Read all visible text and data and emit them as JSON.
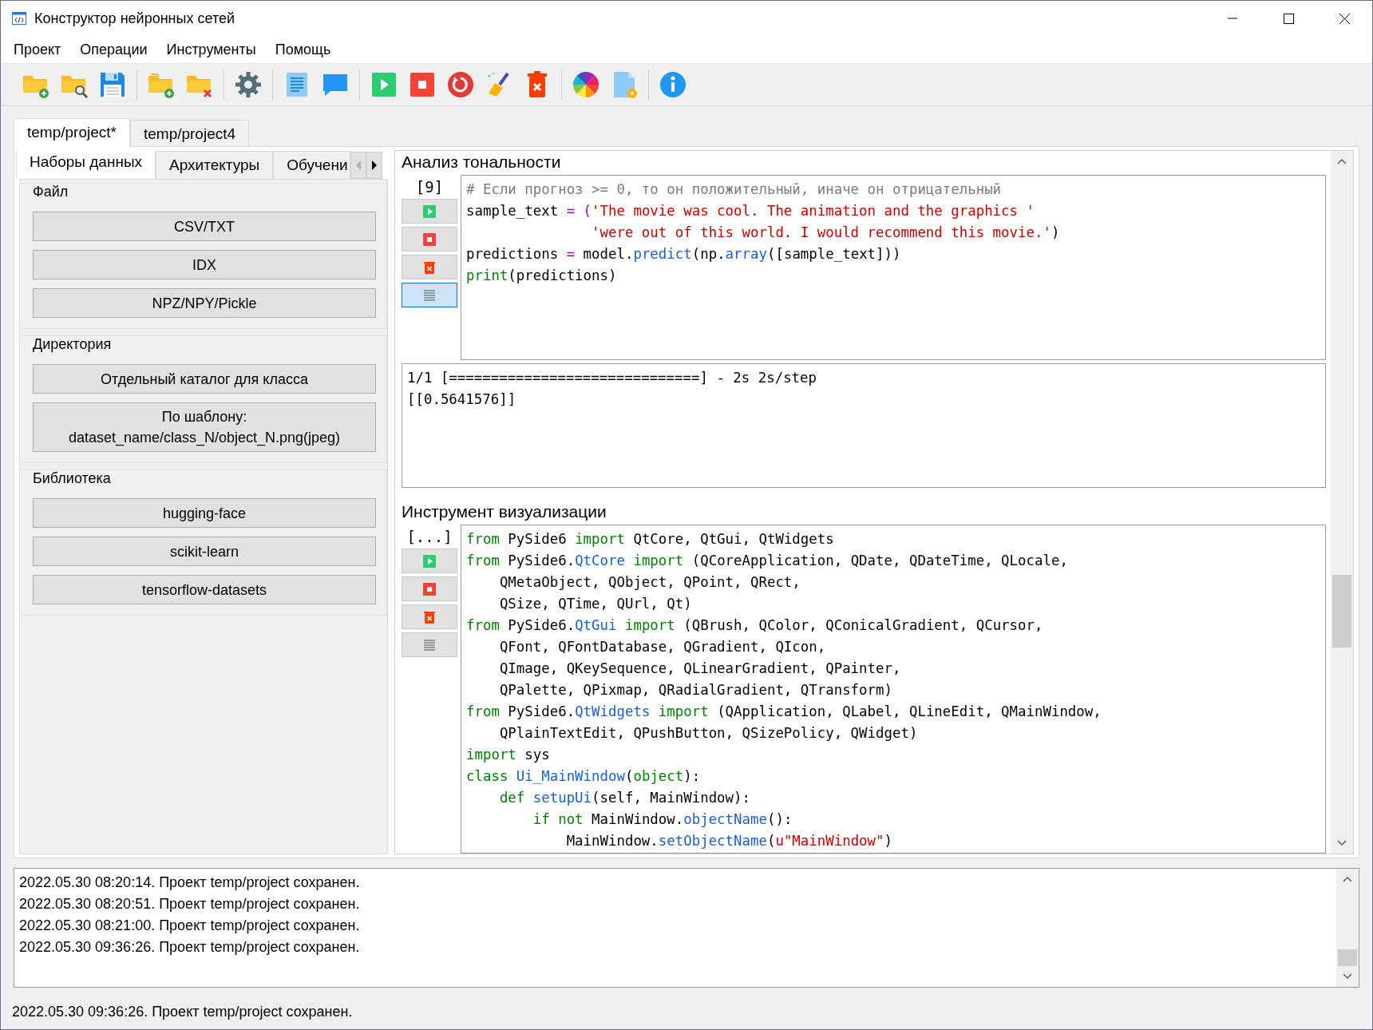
{
  "window": {
    "title": "Конструктор нейронных сетей"
  },
  "menu": [
    {
      "label": "Проект"
    },
    {
      "label": "Операции"
    },
    {
      "label": "Инструменты"
    },
    {
      "label": "Помощь"
    }
  ],
  "project_tabs": [
    {
      "label": "temp/project*",
      "selected": true
    },
    {
      "label": "temp/project4",
      "selected": false
    }
  ],
  "side_tabs": [
    {
      "label": "Наборы данных",
      "selected": true
    },
    {
      "label": "Архитектуры",
      "selected": false
    },
    {
      "label": "Обучени",
      "selected": false
    }
  ],
  "sections": [
    {
      "title": "Файл",
      "buttons": [
        "CSV/TXT",
        "IDX",
        "NPZ/NPY/Pickle"
      ]
    },
    {
      "title": "Директория",
      "buttons": [
        "Отдельный каталог для класса",
        "По шаблону:\ndataset_name/class_N/object_N.png(jpeg)"
      ]
    },
    {
      "title": "Библиотека",
      "buttons": [
        "hugging-face",
        "scikit-learn",
        "tensorflow-datasets"
      ]
    }
  ],
  "cells": [
    {
      "title": "Анализ тональности",
      "prompt": "[9]",
      "output_shown": true,
      "code": [
        [
          {
            "kind": "comment",
            "text": "# Если прогноз >= 0, то он положительный, иначе он отрицательный"
          }
        ],
        [
          {
            "kind": "plain",
            "text": "sample_text "
          },
          {
            "kind": "op",
            "text": "= ("
          },
          {
            "kind": "string",
            "text": "'The movie was cool. The animation and the graphics '"
          }
        ],
        [
          {
            "kind": "string",
            "text": "               'were out of this world. I would recommend this movie.'"
          },
          {
            "kind": "plain",
            "text": ")"
          }
        ],
        [
          {
            "kind": "plain",
            "text": "predictions "
          },
          {
            "kind": "op",
            "text": "="
          },
          {
            "kind": "plain",
            "text": " model."
          },
          {
            "kind": "name",
            "text": "predict"
          },
          {
            "kind": "plain",
            "text": "(np."
          },
          {
            "kind": "name",
            "text": "array"
          },
          {
            "kind": "plain",
            "text": "([sample_text]))"
          }
        ],
        [
          {
            "kind": "keyword",
            "text": "print"
          },
          {
            "kind": "plain",
            "text": "(predictions)"
          }
        ]
      ],
      "output": [
        "1/1 [==============================] - 2s 2s/step",
        "[[0.5641576]]"
      ]
    },
    {
      "title": "Инструмент визуализации",
      "prompt": "[...]",
      "output_shown": false,
      "code": [
        [
          {
            "kind": "keyword",
            "text": "from"
          },
          {
            "kind": "plain",
            "text": " PySide6 "
          },
          {
            "kind": "keyword",
            "text": "import"
          },
          {
            "kind": "plain",
            "text": " QtCore, QtGui, QtWidgets"
          }
        ],
        [
          {
            "kind": "keyword",
            "text": "from"
          },
          {
            "kind": "plain",
            "text": " PySide6."
          },
          {
            "kind": "name",
            "text": "QtCore "
          },
          {
            "kind": "keyword",
            "text": "import"
          },
          {
            "kind": "plain",
            "text": " (QCoreApplication, QDate, QDateTime, QLocale,"
          }
        ],
        [
          {
            "kind": "plain",
            "text": "    QMetaObject, QObject, QPoint, QRect,"
          }
        ],
        [
          {
            "kind": "plain",
            "text": "    QSize, QTime, QUrl, Qt)"
          }
        ],
        [
          {
            "kind": "keyword",
            "text": "from"
          },
          {
            "kind": "plain",
            "text": " PySide6."
          },
          {
            "kind": "name",
            "text": "QtGui "
          },
          {
            "kind": "keyword",
            "text": "import"
          },
          {
            "kind": "plain",
            "text": " (QBrush, QColor, QConicalGradient, QCursor,"
          }
        ],
        [
          {
            "kind": "plain",
            "text": "    QFont, QFontDatabase, QGradient, QIcon,"
          }
        ],
        [
          {
            "kind": "plain",
            "text": "    QImage, QKeySequence, QLinearGradient, QPainter,"
          }
        ],
        [
          {
            "kind": "plain",
            "text": "    QPalette, QPixmap, QRadialGradient, QTransform)"
          }
        ],
        [
          {
            "kind": "keyword",
            "text": "from"
          },
          {
            "kind": "plain",
            "text": " PySide6."
          },
          {
            "kind": "name",
            "text": "QtWidgets "
          },
          {
            "kind": "keyword",
            "text": "import"
          },
          {
            "kind": "plain",
            "text": " (QApplication, QLabel, QLineEdit, QMainWindow,"
          }
        ],
        [
          {
            "kind": "plain",
            "text": "    QPlainTextEdit, QPushButton, QSizePolicy, QWidget)"
          }
        ],
        [
          {
            "kind": "keyword",
            "text": "import"
          },
          {
            "kind": "plain",
            "text": " sys"
          }
        ],
        [
          {
            "kind": "keyword",
            "text": "class "
          },
          {
            "kind": "name",
            "text": "Ui_MainWindow"
          },
          {
            "kind": "plain",
            "text": "("
          },
          {
            "kind": "keyword",
            "text": "object"
          },
          {
            "kind": "plain",
            "text": "):"
          }
        ],
        [
          {
            "kind": "keyword",
            "text": "    def "
          },
          {
            "kind": "name",
            "text": "setupUi"
          },
          {
            "kind": "plain",
            "text": "(self, MainWindow):"
          }
        ],
        [
          {
            "kind": "keyword",
            "text": "        if not"
          },
          {
            "kind": "plain",
            "text": " MainWindow."
          },
          {
            "kind": "name",
            "text": "objectName"
          },
          {
            "kind": "plain",
            "text": "():"
          }
        ],
        [
          {
            "kind": "plain",
            "text": "            MainWindow."
          },
          {
            "kind": "name",
            "text": "setObjectName"
          },
          {
            "kind": "plain",
            "text": "("
          },
          {
            "kind": "string",
            "text": "u\"MainWindow\""
          },
          {
            "kind": "plain",
            "text": ")"
          }
        ]
      ]
    }
  ],
  "log": [
    "2022.05.30 08:20:14. Проект temp/project сохранен.",
    "2022.05.30 08:20:51. Проект temp/project сохранен.",
    "2022.05.30 08:21:00. Проект temp/project сохранен.",
    "2022.05.30 09:36:26. Проект temp/project сохранен."
  ],
  "status_bar": "2022.05.30 09:36:26. Проект temp/project сохранен."
}
